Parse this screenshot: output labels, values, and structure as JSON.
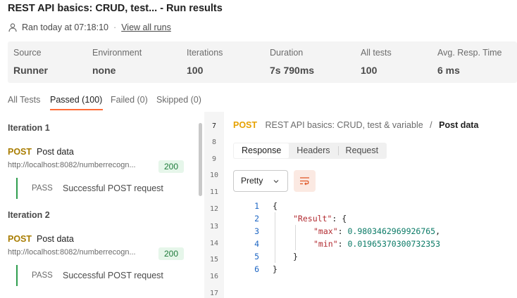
{
  "header": {
    "title": "REST API basics: CRUD, test... - Run results",
    "ran_text": "Ran today at 07:18:10",
    "separator": "·",
    "view_all_runs": "View all runs"
  },
  "stats": [
    {
      "label": "Source",
      "value": "Runner"
    },
    {
      "label": "Environment",
      "value": "none"
    },
    {
      "label": "Iterations",
      "value": "100"
    },
    {
      "label": "Duration",
      "value": "7s 790ms"
    },
    {
      "label": "All tests",
      "value": "100"
    },
    {
      "label": "Avg. Resp. Time",
      "value": "6 ms"
    }
  ],
  "tabs": [
    "All Tests",
    "Passed (100)",
    "Failed (0)",
    "Skipped (0)"
  ],
  "iterations": [
    {
      "title": "Iteration 1",
      "method": "POST",
      "name": "Post data",
      "url": "http://localhost:8082/numberrecogn...",
      "status": "200",
      "result": "PASS",
      "message": "Successful POST request"
    },
    {
      "title": "Iteration 2",
      "method": "POST",
      "name": "Post data",
      "url": "http://localhost:8082/numberrecogn...",
      "status": "200",
      "result": "PASS",
      "message": "Successful POST request"
    }
  ],
  "gutter_lines": [
    "7",
    "8",
    "9",
    "10",
    "11",
    "12",
    "13",
    "14",
    "15",
    "16",
    "17"
  ],
  "detail": {
    "method": "POST",
    "collection": "REST API basics: CRUD, test & variable",
    "crumb_sep": "/",
    "request_name": "Post data",
    "tabs": [
      "Response",
      "Headers",
      "Request"
    ],
    "format": "Pretty",
    "code_lines": [
      {
        "n": "1",
        "indent": 0,
        "parts": [
          {
            "t": "{",
            "c": ""
          }
        ]
      },
      {
        "n": "2",
        "indent": 1,
        "parts": [
          {
            "t": "\"Result\"",
            "c": "key"
          },
          {
            "t": ": {",
            "c": ""
          }
        ]
      },
      {
        "n": "3",
        "indent": 2,
        "parts": [
          {
            "t": "\"max\"",
            "c": "key"
          },
          {
            "t": ": ",
            "c": ""
          },
          {
            "t": "0.9803462969926765",
            "c": "num"
          },
          {
            "t": ",",
            "c": ""
          }
        ]
      },
      {
        "n": "4",
        "indent": 2,
        "parts": [
          {
            "t": "\"min\"",
            "c": "key"
          },
          {
            "t": ": ",
            "c": ""
          },
          {
            "t": "0.01965370300732353",
            "c": "num"
          }
        ]
      },
      {
        "n": "5",
        "indent": 1,
        "parts": [
          {
            "t": "}",
            "c": ""
          }
        ]
      },
      {
        "n": "6",
        "indent": 0,
        "parts": [
          {
            "t": "}",
            "c": ""
          }
        ]
      }
    ]
  },
  "colors": {
    "accent": "#ff6c37",
    "post_method": "#a87c00",
    "pass_green": "#2f9e4f"
  }
}
